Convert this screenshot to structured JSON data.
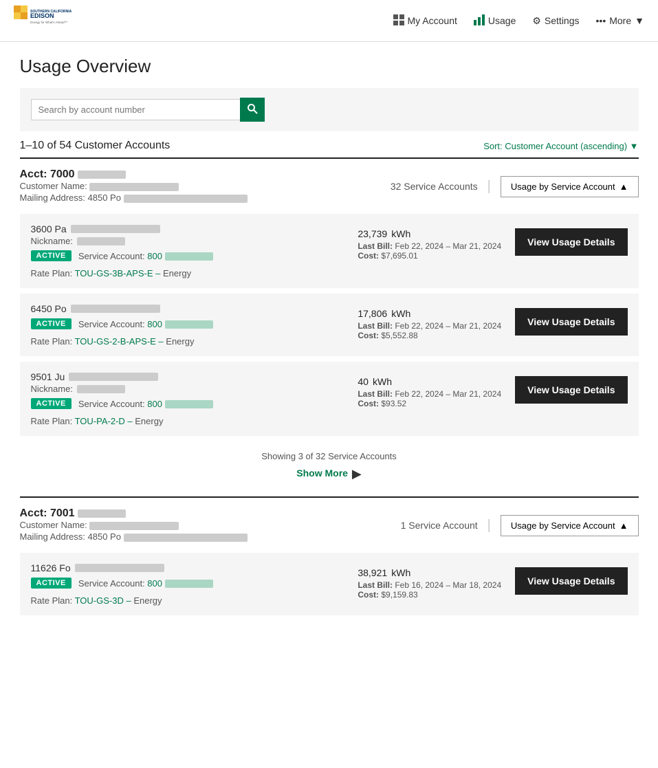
{
  "header": {
    "logo_alt": "Southern California Edison",
    "logo_sub": "Energy for What's Ahead",
    "nav": [
      {
        "label": "My Account",
        "icon": "grid-icon",
        "active": true
      },
      {
        "label": "Usage",
        "icon": "bar-chart-icon",
        "active": false
      },
      {
        "label": "Settings",
        "icon": "gear-icon",
        "active": false
      },
      {
        "label": "More",
        "icon": "dots-icon",
        "active": false
      }
    ]
  },
  "page_title": "Usage Overview",
  "search": {
    "placeholder": "Search by account number",
    "button_label": "🔍"
  },
  "results": {
    "count_text": "1–10 of 54 Customer Accounts",
    "sort_text": "Sort: Customer Account (ascending)"
  },
  "customer_accounts": [
    {
      "acct_num": "Acct: 7000",
      "customer_name_label": "Customer Name:",
      "mailing_address_label": "Mailing Address:",
      "mailing_address_prefix": "4850 Po",
      "service_accounts_count": "32 Service Accounts",
      "dropdown_label": "Usage by Service Account",
      "service_accounts": [
        {
          "address": "3600 Pa",
          "nickname_label": "Nickname:",
          "status": "ACTIVE",
          "account_num_label": "Service Account:",
          "account_num": "800",
          "rate_plan_label": "Rate Plan:",
          "rate_plan": "TOU-GS-3B-APS-E –",
          "rate_plan_suffix": "Energy",
          "kwh": "23,739",
          "kwh_unit": "kWh",
          "last_bill_label": "Last Bill:",
          "last_bill_date": "Feb 22, 2024 – Mar 21, 2024",
          "cost_label": "Cost:",
          "cost": "$7,695.01",
          "btn_label": "View Usage Details"
        },
        {
          "address": "6450 Po",
          "nickname_label": null,
          "status": "ACTIVE",
          "account_num_label": "Service Account:",
          "account_num": "800",
          "rate_plan_label": "Rate Plan:",
          "rate_plan": "TOU-GS-2-B-APS-E –",
          "rate_plan_suffix": "Energy",
          "kwh": "17,806",
          "kwh_unit": "kWh",
          "last_bill_label": "Last Bill:",
          "last_bill_date": "Feb 22, 2024 – Mar 21, 2024",
          "cost_label": "Cost:",
          "cost": "$5,552.88",
          "btn_label": "View Usage Details"
        },
        {
          "address": "9501 Ju",
          "nickname_label": "Nickname:",
          "status": "ACTIVE",
          "account_num_label": "Service Account:",
          "account_num": "800",
          "rate_plan_label": "Rate Plan:",
          "rate_plan": "TOU-PA-2-D –",
          "rate_plan_suffix": "Energy",
          "kwh": "40",
          "kwh_unit": "kWh",
          "last_bill_label": "Last Bill:",
          "last_bill_date": "Feb 22, 2024 – Mar 21, 2024",
          "cost_label": "Cost:",
          "cost": "$93.52",
          "btn_label": "View Usage Details"
        }
      ],
      "showing_text": "Showing 3 of 32 Service Accounts",
      "show_more_label": "Show More"
    },
    {
      "acct_num": "Acct: 7001",
      "customer_name_label": "Customer Name:",
      "mailing_address_label": "Mailing Address:",
      "mailing_address_prefix": "4850 Po",
      "service_accounts_count": "1 Service Account",
      "dropdown_label": "Usage by Service Account",
      "service_accounts": [
        {
          "address": "11626 Fo",
          "nickname_label": null,
          "status": "ACTIVE",
          "account_num_label": "Service Account:",
          "account_num": "800",
          "rate_plan_label": "Rate Plan:",
          "rate_plan": "TOU-GS-3D –",
          "rate_plan_suffix": "Energy",
          "kwh": "38,921",
          "kwh_unit": "kWh",
          "last_bill_label": "Last Bill:",
          "last_bill_date": "Feb 16, 2024 – Mar 18, 2024",
          "cost_label": "Cost:",
          "cost": "$9,159.83",
          "btn_label": "View Usage Details"
        }
      ],
      "showing_text": null,
      "show_more_label": null
    }
  ]
}
